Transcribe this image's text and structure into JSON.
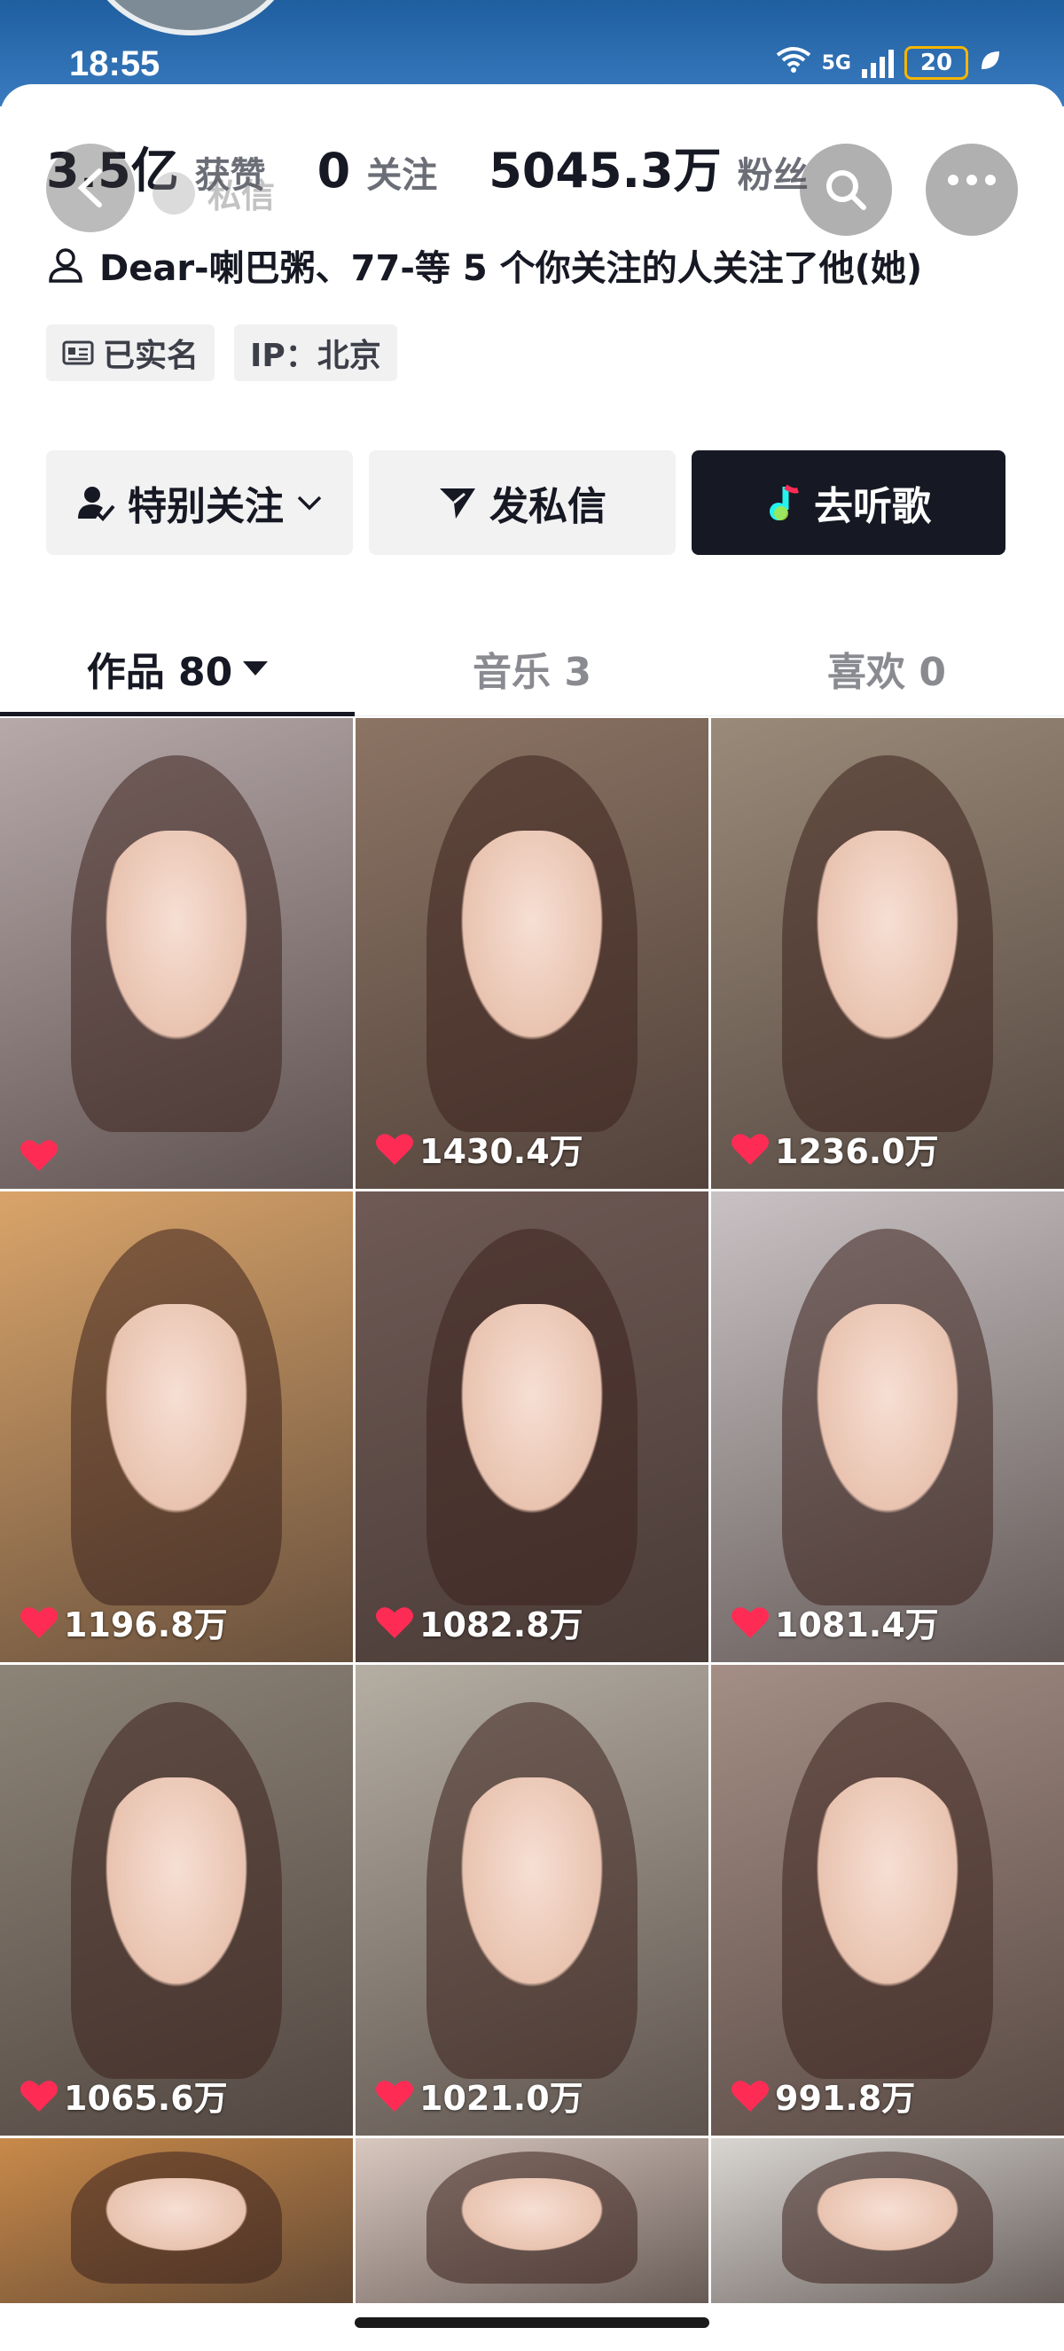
{
  "status_bar": {
    "time": "18:55",
    "network": "5G",
    "battery": "20",
    "wifi_icon": "wifi-icon",
    "leaf_icon": "leaf-icon"
  },
  "header": {
    "ghost_name": "私信"
  },
  "stats": [
    {
      "value": "3.5亿",
      "label": "获赞"
    },
    {
      "value": "0",
      "label": "关注"
    },
    {
      "value": "5045.3万",
      "label": "粉丝"
    }
  ],
  "followed_by": "Dear-喇巴粥、77-等 5 个你关注的人关注了他(她)",
  "tags": [
    {
      "label": "已实名"
    },
    {
      "label": "IP：北京"
    }
  ],
  "actions": {
    "follow": "特别关注",
    "message": "发私信",
    "music": "去听歌"
  },
  "tabs": [
    {
      "label": "作品 80"
    },
    {
      "label": "音乐 3"
    },
    {
      "label": "喜欢 0"
    }
  ],
  "videos": [
    {
      "likes": "",
      "bg": "#b7a9aa"
    },
    {
      "likes": "1430.4万",
      "bg": "#8c7464"
    },
    {
      "likes": "1236.0万",
      "bg": "#9a8a79"
    },
    {
      "likes": "1196.8万",
      "bg": "#d9a46a"
    },
    {
      "likes": "1082.8万",
      "bg": "#6f5a55"
    },
    {
      "likes": "1081.4万",
      "bg": "#c9c2c4"
    },
    {
      "likes": "1065.6万",
      "bg": "#8d8478"
    },
    {
      "likes": "1021.0万",
      "bg": "#b5aea3"
    },
    {
      "likes": "991.8万",
      "bg": "#a48e85"
    },
    {
      "likes": "",
      "bg": "#c98a4a"
    },
    {
      "likes": "",
      "bg": "#d8c8c0"
    },
    {
      "likes": "",
      "bg": "#d9d6d2"
    }
  ],
  "colors": {
    "accent_dark": "#161823",
    "heart": "#fe2c55"
  }
}
